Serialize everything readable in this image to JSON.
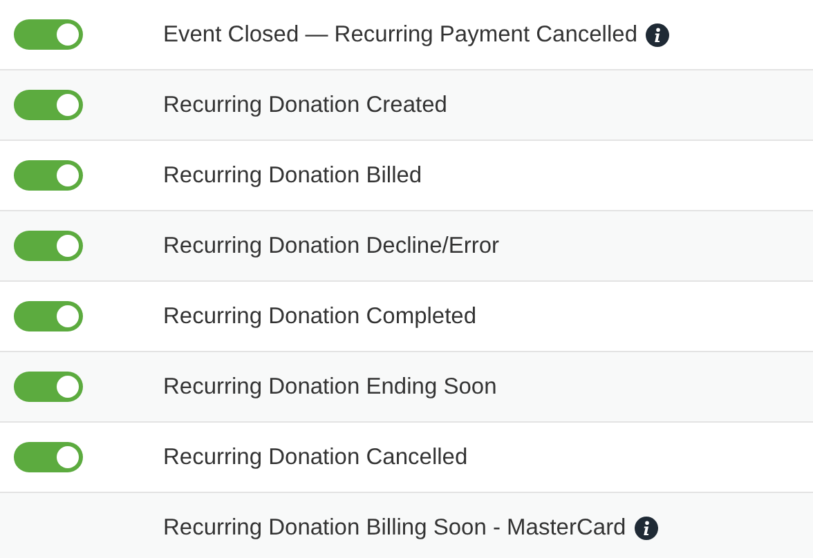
{
  "rows": [
    {
      "kind": "toggle",
      "on": true,
      "label": "Event Closed — Recurring Payment Cancelled",
      "info": true
    },
    {
      "kind": "toggle",
      "on": true,
      "label": "Recurring Donation Created",
      "info": false
    },
    {
      "kind": "toggle",
      "on": true,
      "label": "Recurring Donation Billed",
      "info": false
    },
    {
      "kind": "toggle",
      "on": true,
      "label": "Recurring Donation Decline/Error",
      "info": false
    },
    {
      "kind": "toggle",
      "on": true,
      "label": "Recurring Donation Completed",
      "info": false
    },
    {
      "kind": "toggle",
      "on": true,
      "label": "Recurring Donation Ending Soon",
      "info": false
    },
    {
      "kind": "toggle",
      "on": true,
      "label": "Recurring Donation Cancelled",
      "info": false
    },
    {
      "kind": "text",
      "label": "Recurring Donation Billing Soon - MasterCard",
      "info": true
    }
  ]
}
